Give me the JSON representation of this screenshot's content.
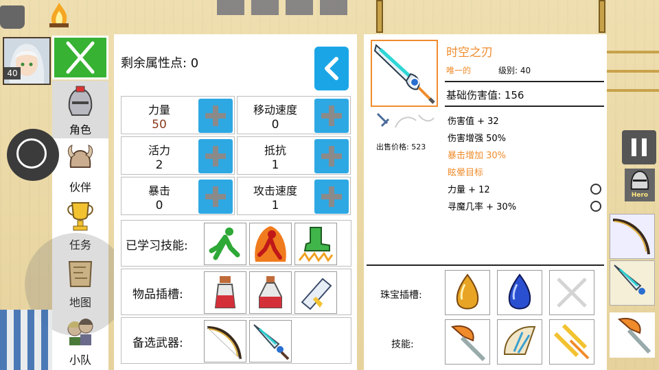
{
  "hud": {
    "player_level": "40",
    "hero_label": "Hero"
  },
  "nav": {
    "items": [
      {
        "label": "角色",
        "icon": "helmet-icon"
      },
      {
        "label": "伙伴",
        "icon": "horned-helmet-icon"
      },
      {
        "label": "任务",
        "icon": "trophy-icon"
      },
      {
        "label": "地图",
        "icon": "map-scroll-icon"
      },
      {
        "label": "小队",
        "icon": "party-icon"
      }
    ]
  },
  "attributes": {
    "remaining_label": "剩余属性点: 0",
    "stats": [
      {
        "name": "力量",
        "value": "50",
        "highlight": true
      },
      {
        "name": "移动速度",
        "value": "0"
      },
      {
        "name": "活力",
        "value": "2"
      },
      {
        "name": "抵抗",
        "value": "1"
      },
      {
        "name": "暴击",
        "value": "0"
      },
      {
        "name": "攻击速度",
        "value": "1"
      }
    ],
    "learned_skills_label": "已学习技能:",
    "item_slots_label": "物品插槽:",
    "backup_weapons_label": "备选武器:"
  },
  "item": {
    "name": "时空之刃",
    "rarity": "唯一的",
    "level_label": "级别: 40",
    "base_damage": "基础伤害值: 156",
    "sell_price": "出售价格: 523",
    "affixes": [
      {
        "text": "伤害值 + 32",
        "color": "#111111"
      },
      {
        "text": "伤害增强 50%",
        "color": "#111111"
      },
      {
        "text": "暴击增加 30%",
        "color": "#f08b2b"
      },
      {
        "text": "眩晕目标",
        "color": "#f08b2b"
      },
      {
        "text": "力量 + 12",
        "color": "#111111",
        "reroll": true
      },
      {
        "text": "寻魔几率 + 30%",
        "color": "#111111",
        "reroll": true
      }
    ],
    "gem_slots_label": "珠宝插槽:",
    "skills_label": "技能:"
  },
  "colors": {
    "accent_orange": "#f08b2b",
    "close_green": "#37b233",
    "plus_blue": "#2ea8e3",
    "back_blue": "#1aa6e6"
  }
}
